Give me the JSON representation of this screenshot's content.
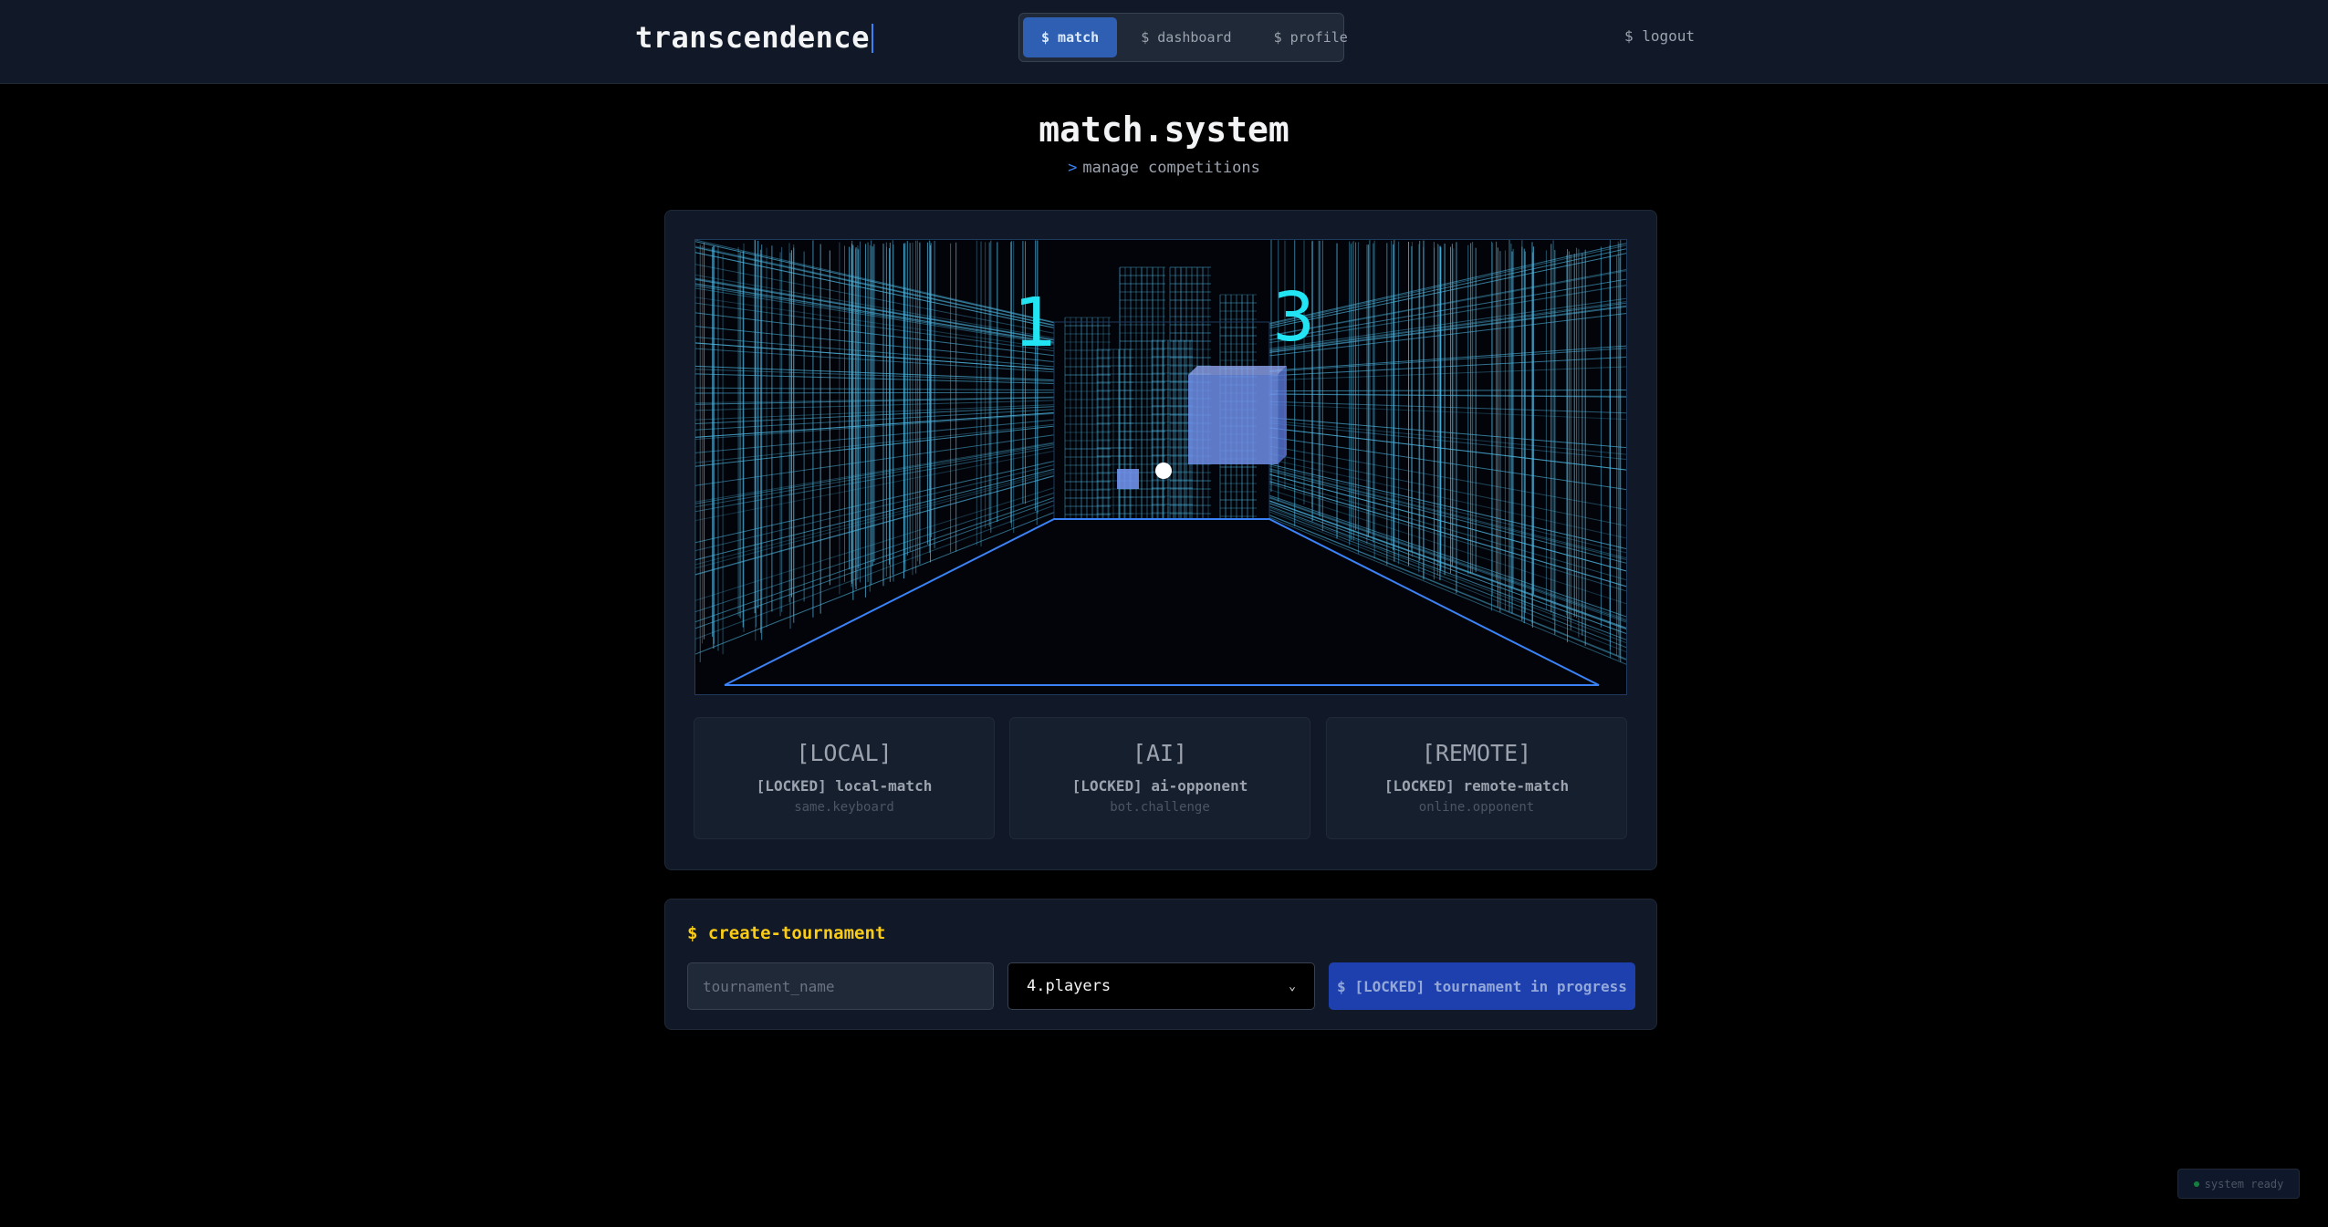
{
  "header": {
    "brand": "transcendence",
    "nav": [
      {
        "label": "$ match",
        "active": true
      },
      {
        "label": "$ dashboard",
        "active": false
      },
      {
        "label": "$ profile",
        "active": false
      }
    ],
    "logout": "$ logout"
  },
  "page": {
    "title": "match.system",
    "subtitle_prompt": ">",
    "subtitle": "manage competitions"
  },
  "game": {
    "score_left": "1",
    "score_right": "3",
    "accent_color": "#22e4f2",
    "grid_color": "#4fb6e0"
  },
  "modes": [
    {
      "tag": "[LOCAL]",
      "status": "[LOCKED] local-match",
      "desc": "same.keyboard"
    },
    {
      "tag": "[AI]",
      "status": "[LOCKED] ai-opponent",
      "desc": "bot.challenge"
    },
    {
      "tag": "[REMOTE]",
      "status": "[LOCKED] remote-match",
      "desc": "online.opponent"
    }
  ],
  "tournament": {
    "title": "$ create-tournament",
    "name_placeholder": "tournament_name",
    "players_selected": "4.players",
    "button": "$ [LOCKED] tournament in progress"
  },
  "status": {
    "text": "system ready"
  }
}
